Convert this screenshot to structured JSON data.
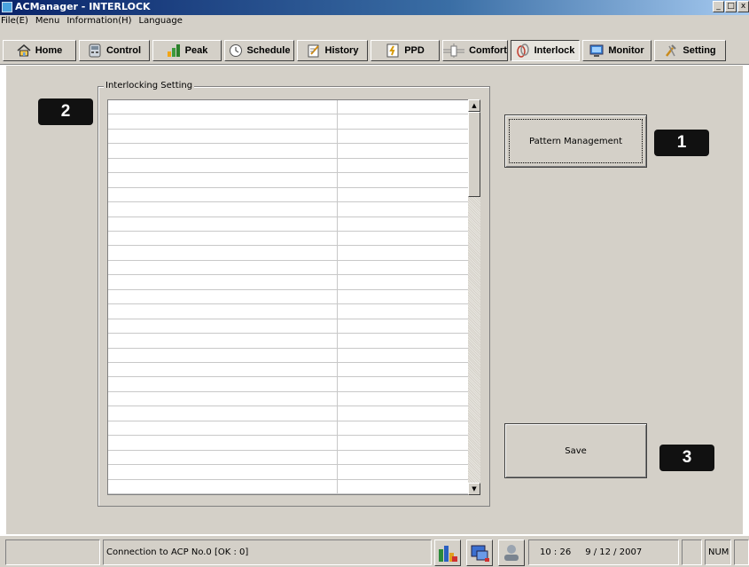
{
  "window": {
    "title": "ACManager - INTERLOCK",
    "buttons": [
      "_",
      "□",
      "x"
    ]
  },
  "menu": {
    "items": [
      "File(E)",
      "Menu",
      "Information(H)",
      "Language"
    ]
  },
  "tabs": [
    {
      "label": "Home",
      "icon": "home-icon"
    },
    {
      "label": "Control",
      "icon": "control-icon"
    },
    {
      "label": "Peak",
      "icon": "peak-icon"
    },
    {
      "label": "Schedule",
      "icon": "schedule-icon"
    },
    {
      "label": "History",
      "icon": "history-icon"
    },
    {
      "label": "PPD",
      "icon": "ppd-icon"
    },
    {
      "label": "Comfort",
      "icon": "comfort-icon"
    },
    {
      "label": "Interlock",
      "icon": "interlock-icon"
    },
    {
      "label": "Monitor",
      "icon": "monitor-icon"
    },
    {
      "label": "Setting",
      "icon": "setting-icon"
    }
  ],
  "active_tab": "Interlock",
  "group": {
    "label": "Interlocking Setting"
  },
  "table": {
    "rows": 27,
    "columns": 2
  },
  "buttons": {
    "pattern_management": "Pattern Management",
    "save": "Save"
  },
  "callouts": {
    "c1": "1",
    "c2": "2",
    "c3": "3"
  },
  "status": {
    "connection": "Connection to ACP No.0 [OK : 0]",
    "time": "10 : 26",
    "date": "9 / 12 / 2007",
    "num": "NUM"
  }
}
